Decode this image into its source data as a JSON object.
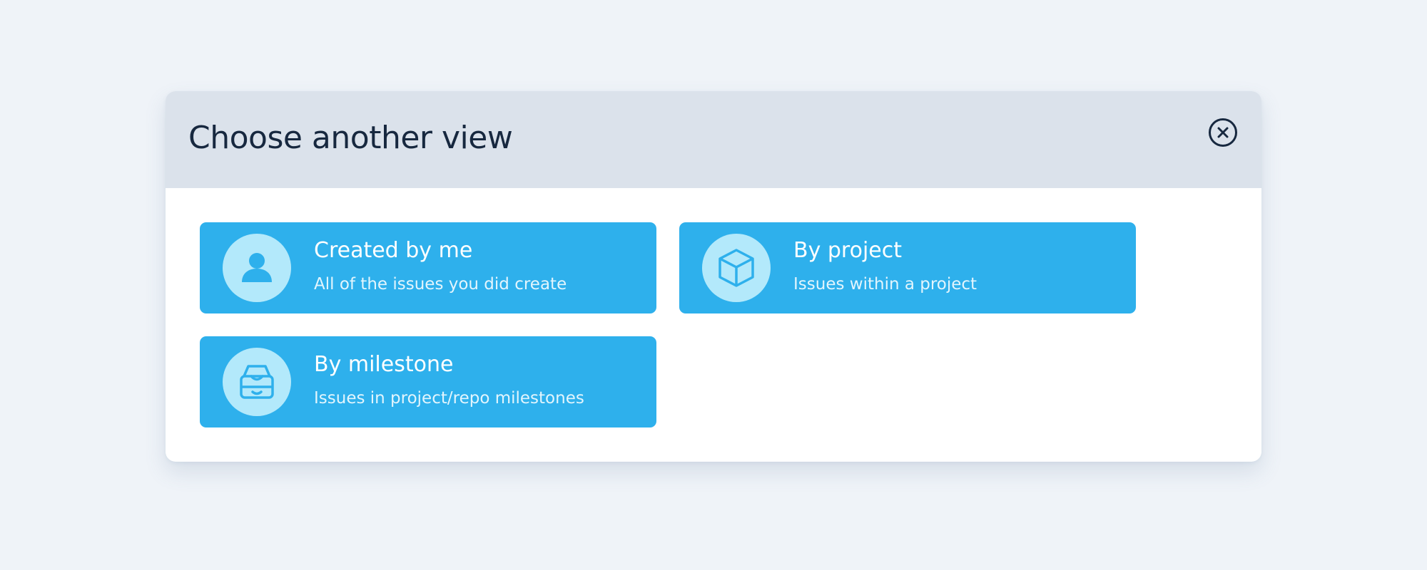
{
  "dialog": {
    "title": "Choose another view",
    "close_icon": "close-circle-icon"
  },
  "options": [
    {
      "title": "Created by me",
      "description": "All of the issues you did create",
      "icon": "user-icon"
    },
    {
      "title": "By project",
      "description": "Issues within a project",
      "icon": "cube-icon"
    },
    {
      "title": "By milestone",
      "description": "Issues in project/repo milestones",
      "icon": "inbox-icon"
    }
  ],
  "colors": {
    "background": "#eff3f8",
    "header": "#dbe2eb",
    "card": "#2eb0ec",
    "icon_circle": "#b3e9fb",
    "title_text": "#17283f"
  }
}
